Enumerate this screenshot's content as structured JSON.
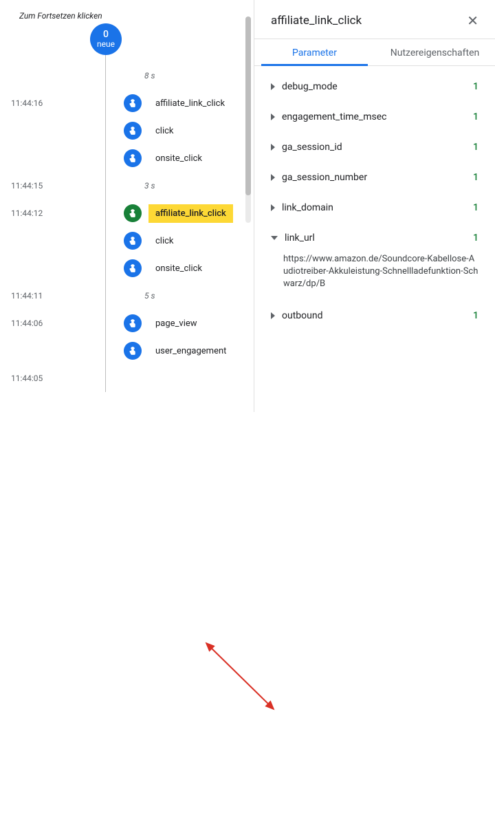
{
  "left": {
    "resume_hint": "Zum Fortsetzen klicken",
    "new_count": "0",
    "new_label": "neue",
    "events": [
      {
        "kind": "gap",
        "ts": "",
        "label": "8 s"
      },
      {
        "kind": "event",
        "ts": "11:44:16",
        "label": "affiliate_link_click",
        "selected": false
      },
      {
        "kind": "event",
        "ts": "",
        "label": "click",
        "selected": false
      },
      {
        "kind": "event",
        "ts": "",
        "label": "onsite_click",
        "selected": false
      },
      {
        "kind": "gap",
        "ts": "11:44:15",
        "label": "3 s"
      },
      {
        "kind": "event",
        "ts": "11:44:12",
        "label": "affiliate_link_click",
        "selected": true
      },
      {
        "kind": "event",
        "ts": "",
        "label": "click",
        "selected": false
      },
      {
        "kind": "event",
        "ts": "",
        "label": "onsite_click",
        "selected": false
      },
      {
        "kind": "gap",
        "ts": "11:44:11",
        "label": "5 s"
      },
      {
        "kind": "event",
        "ts": "11:44:06",
        "label": "page_view",
        "selected": false
      },
      {
        "kind": "event",
        "ts": "",
        "label": "user_engagement",
        "selected": false
      },
      {
        "kind": "gap",
        "ts": "11:44:05",
        "label": ""
      }
    ]
  },
  "right": {
    "title": "affiliate_link_click",
    "tabs": {
      "parameter": "Parameter",
      "userprops": "Nutzereigenschaften"
    },
    "params": [
      {
        "name": "debug_mode",
        "count": "1",
        "expanded": false
      },
      {
        "name": "engagement_time_msec",
        "count": "1",
        "expanded": false
      },
      {
        "name": "ga_session_id",
        "count": "1",
        "expanded": false
      },
      {
        "name": "ga_session_number",
        "count": "1",
        "expanded": false
      },
      {
        "name": "link_domain",
        "count": "1",
        "expanded": false
      },
      {
        "name": "link_url",
        "count": "1",
        "expanded": true,
        "value": "https://www.amazon.de/Soundcore-Kabellose-Audiotreiber-Akkuleistung-Schnellladefunktion-Schwarz/dp/B"
      },
      {
        "name": "outbound",
        "count": "1",
        "expanded": false
      }
    ]
  }
}
